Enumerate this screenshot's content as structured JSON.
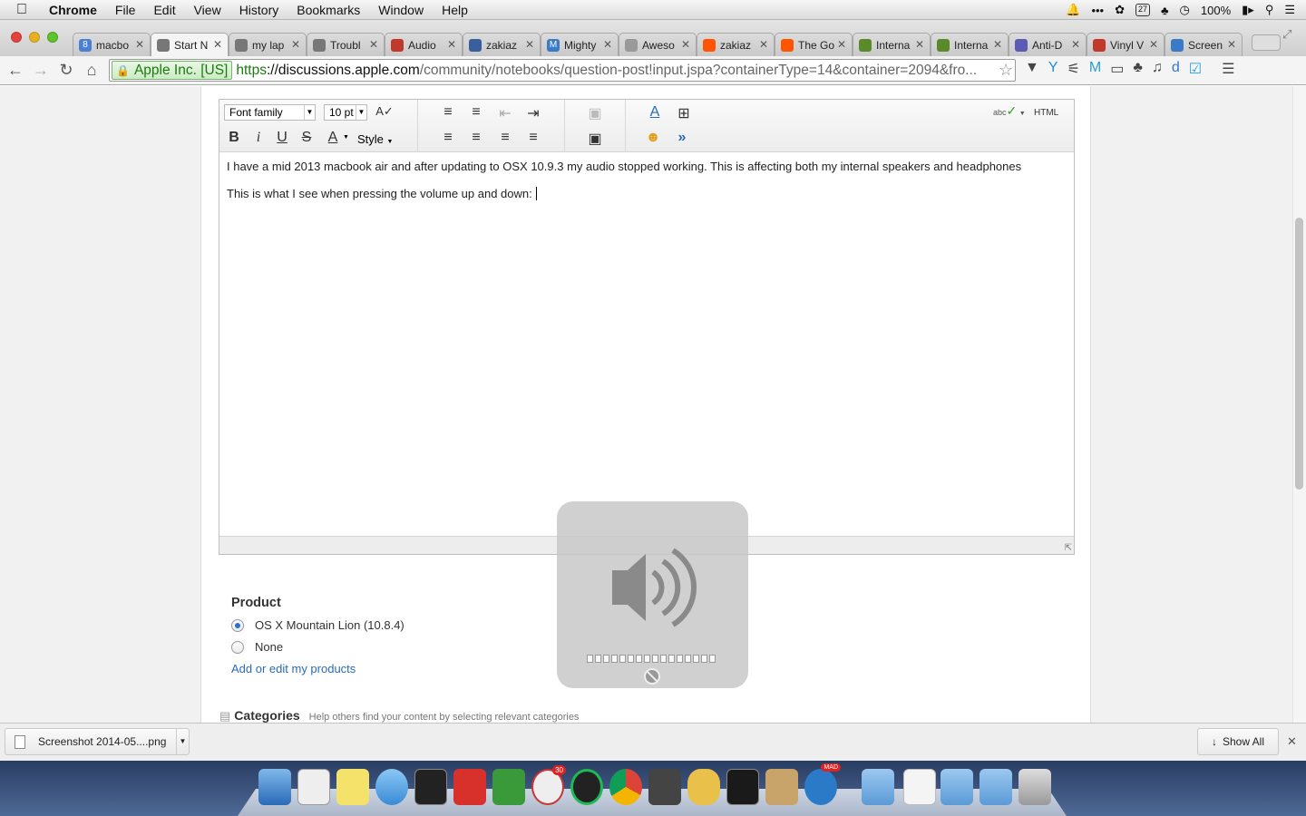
{
  "menubar": {
    "app": "Chrome",
    "items": [
      "File",
      "Edit",
      "View",
      "History",
      "Bookmarks",
      "Window",
      "Help"
    ],
    "calendar": "27",
    "battery": "100%"
  },
  "tabs": [
    {
      "label": "macbo",
      "icon_color": "#4a7fd6",
      "icon": "8"
    },
    {
      "label": "Start N",
      "icon_color": "#777",
      "icon": ""
    },
    {
      "label": "my lap",
      "icon_color": "#777",
      "icon": ""
    },
    {
      "label": "Troubl",
      "icon_color": "#777",
      "icon": ""
    },
    {
      "label": "Audio",
      "icon_color": "#c0392b",
      "icon": ""
    },
    {
      "label": "zakiaz",
      "icon_color": "#3a5f9e",
      "icon": ""
    },
    {
      "label": "Mighty",
      "icon_color": "#3a7bc8",
      "icon": "M"
    },
    {
      "label": "Aweso",
      "icon_color": "#999",
      "icon": ""
    },
    {
      "label": "zakiaz",
      "icon_color": "#ff5500",
      "icon": ""
    },
    {
      "label": "The Go",
      "icon_color": "#ff5500",
      "icon": ""
    },
    {
      "label": "Interna",
      "icon_color": "#5a8a2a",
      "icon": ""
    },
    {
      "label": "Interna",
      "icon_color": "#5a8a2a",
      "icon": ""
    },
    {
      "label": "Anti-D",
      "icon_color": "#5b5bb5",
      "icon": ""
    },
    {
      "label": "Vinyl V",
      "icon_color": "#c0392b",
      "icon": ""
    },
    {
      "label": "Screen",
      "icon_color": "#3a7bc8",
      "icon": ""
    }
  ],
  "toolbar": {
    "ev_badge": "Apple Inc. [US]",
    "url_https": "https",
    "url_host": "://discussions.apple.com",
    "url_rest": "/community/notebooks/question-post!input.jspa?containerType=14&container=2094&fro..."
  },
  "editor": {
    "font_family": "Font family",
    "font_size": "10 pt",
    "style_label": "Style",
    "html_label": "HTML",
    "spell_label": "abc",
    "line1": "I have a mid 2013 macbook air and after updating to OSX 10.9.3 my audio stopped working. This is affecting both my internal speakers and headphones",
    "line2": "This is what I see when pressing the volume up and down: "
  },
  "product": {
    "heading": "Product",
    "options": [
      {
        "label": "OS X Mountain Lion (10.8.4)",
        "selected": true
      },
      {
        "label": "None",
        "selected": false
      }
    ],
    "link": "Add or edit my products"
  },
  "categories": {
    "heading": "Categories",
    "hint": "Help others find your content by selecting relevant categories"
  },
  "volume_hud": {
    "level": 0,
    "segments": 16,
    "muted": true
  },
  "downloads": {
    "file": "Screenshot 2014-05....png",
    "show_all": "Show All"
  },
  "dock": {
    "badge_calendar": "30",
    "badge_mad": "MAD"
  }
}
